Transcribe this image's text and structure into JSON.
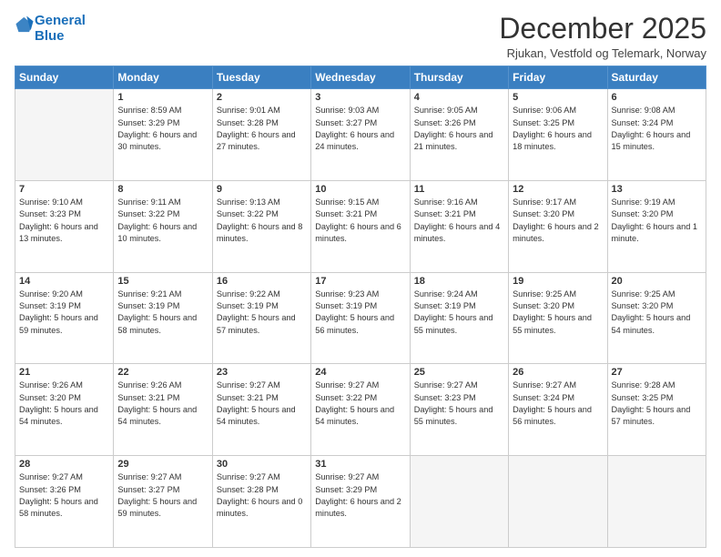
{
  "logo": {
    "line1": "General",
    "line2": "Blue"
  },
  "title": "December 2025",
  "location": "Rjukan, Vestfold og Telemark, Norway",
  "days_header": [
    "Sunday",
    "Monday",
    "Tuesday",
    "Wednesday",
    "Thursday",
    "Friday",
    "Saturday"
  ],
  "weeks": [
    [
      {
        "day": "",
        "empty": true
      },
      {
        "day": "1",
        "sunrise": "8:59 AM",
        "sunset": "3:29 PM",
        "daylight": "6 hours and 30 minutes."
      },
      {
        "day": "2",
        "sunrise": "9:01 AM",
        "sunset": "3:28 PM",
        "daylight": "6 hours and 27 minutes."
      },
      {
        "day": "3",
        "sunrise": "9:03 AM",
        "sunset": "3:27 PM",
        "daylight": "6 hours and 24 minutes."
      },
      {
        "day": "4",
        "sunrise": "9:05 AM",
        "sunset": "3:26 PM",
        "daylight": "6 hours and 21 minutes."
      },
      {
        "day": "5",
        "sunrise": "9:06 AM",
        "sunset": "3:25 PM",
        "daylight": "6 hours and 18 minutes."
      },
      {
        "day": "6",
        "sunrise": "9:08 AM",
        "sunset": "3:24 PM",
        "daylight": "6 hours and 15 minutes."
      }
    ],
    [
      {
        "day": "7",
        "sunrise": "9:10 AM",
        "sunset": "3:23 PM",
        "daylight": "6 hours and 13 minutes."
      },
      {
        "day": "8",
        "sunrise": "9:11 AM",
        "sunset": "3:22 PM",
        "daylight": "6 hours and 10 minutes."
      },
      {
        "day": "9",
        "sunrise": "9:13 AM",
        "sunset": "3:22 PM",
        "daylight": "6 hours and 8 minutes."
      },
      {
        "day": "10",
        "sunrise": "9:15 AM",
        "sunset": "3:21 PM",
        "daylight": "6 hours and 6 minutes."
      },
      {
        "day": "11",
        "sunrise": "9:16 AM",
        "sunset": "3:21 PM",
        "daylight": "6 hours and 4 minutes."
      },
      {
        "day": "12",
        "sunrise": "9:17 AM",
        "sunset": "3:20 PM",
        "daylight": "6 hours and 2 minutes."
      },
      {
        "day": "13",
        "sunrise": "9:19 AM",
        "sunset": "3:20 PM",
        "daylight": "6 hours and 1 minute."
      }
    ],
    [
      {
        "day": "14",
        "sunrise": "9:20 AM",
        "sunset": "3:19 PM",
        "daylight": "5 hours and 59 minutes."
      },
      {
        "day": "15",
        "sunrise": "9:21 AM",
        "sunset": "3:19 PM",
        "daylight": "5 hours and 58 minutes."
      },
      {
        "day": "16",
        "sunrise": "9:22 AM",
        "sunset": "3:19 PM",
        "daylight": "5 hours and 57 minutes."
      },
      {
        "day": "17",
        "sunrise": "9:23 AM",
        "sunset": "3:19 PM",
        "daylight": "5 hours and 56 minutes."
      },
      {
        "day": "18",
        "sunrise": "9:24 AM",
        "sunset": "3:19 PM",
        "daylight": "5 hours and 55 minutes."
      },
      {
        "day": "19",
        "sunrise": "9:25 AM",
        "sunset": "3:20 PM",
        "daylight": "5 hours and 55 minutes."
      },
      {
        "day": "20",
        "sunrise": "9:25 AM",
        "sunset": "3:20 PM",
        "daylight": "5 hours and 54 minutes."
      }
    ],
    [
      {
        "day": "21",
        "sunrise": "9:26 AM",
        "sunset": "3:20 PM",
        "daylight": "5 hours and 54 minutes."
      },
      {
        "day": "22",
        "sunrise": "9:26 AM",
        "sunset": "3:21 PM",
        "daylight": "5 hours and 54 minutes."
      },
      {
        "day": "23",
        "sunrise": "9:27 AM",
        "sunset": "3:21 PM",
        "daylight": "5 hours and 54 minutes."
      },
      {
        "day": "24",
        "sunrise": "9:27 AM",
        "sunset": "3:22 PM",
        "daylight": "5 hours and 54 minutes."
      },
      {
        "day": "25",
        "sunrise": "9:27 AM",
        "sunset": "3:23 PM",
        "daylight": "5 hours and 55 minutes."
      },
      {
        "day": "26",
        "sunrise": "9:27 AM",
        "sunset": "3:24 PM",
        "daylight": "5 hours and 56 minutes."
      },
      {
        "day": "27",
        "sunrise": "9:28 AM",
        "sunset": "3:25 PM",
        "daylight": "5 hours and 57 minutes."
      }
    ],
    [
      {
        "day": "28",
        "sunrise": "9:27 AM",
        "sunset": "3:26 PM",
        "daylight": "5 hours and 58 minutes."
      },
      {
        "day": "29",
        "sunrise": "9:27 AM",
        "sunset": "3:27 PM",
        "daylight": "5 hours and 59 minutes."
      },
      {
        "day": "30",
        "sunrise": "9:27 AM",
        "sunset": "3:28 PM",
        "daylight": "6 hours and 0 minutes."
      },
      {
        "day": "31",
        "sunrise": "9:27 AM",
        "sunset": "3:29 PM",
        "daylight": "6 hours and 2 minutes."
      },
      {
        "day": "",
        "empty": true
      },
      {
        "day": "",
        "empty": true
      },
      {
        "day": "",
        "empty": true
      }
    ]
  ]
}
